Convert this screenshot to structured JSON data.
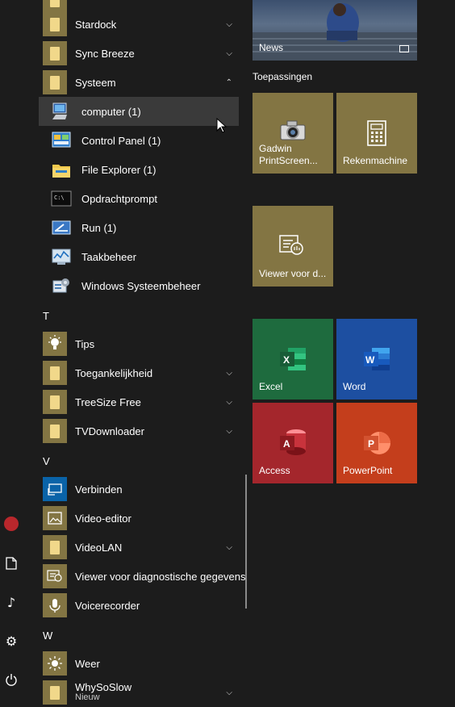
{
  "rail": {
    "icons": [
      "user-avatar",
      "documents-icon",
      "music-icon",
      "settings-icon",
      "power-icon"
    ]
  },
  "list": {
    "items": [
      {
        "type": "app",
        "label": "",
        "icon": "folder"
      },
      {
        "type": "app",
        "label": "Stardock",
        "icon": "folder",
        "chevron": "down"
      },
      {
        "type": "app",
        "label": "Sync Breeze",
        "icon": "folder",
        "chevron": "down"
      },
      {
        "type": "app",
        "label": "Systeem",
        "icon": "folder",
        "chevron": "up"
      },
      {
        "type": "sub",
        "label": "computer (1)",
        "icon": "computer",
        "highlighted": true
      },
      {
        "type": "sub",
        "label": "Control Panel (1)",
        "icon": "control-panel"
      },
      {
        "type": "sub",
        "label": "File Explorer (1)",
        "icon": "file-explorer"
      },
      {
        "type": "sub",
        "label": "Opdrachtprompt",
        "icon": "command-prompt"
      },
      {
        "type": "sub",
        "label": "Run (1)",
        "icon": "run"
      },
      {
        "type": "sub",
        "label": "Taakbeheer",
        "icon": "task-manager"
      },
      {
        "type": "sub",
        "label": "Windows Systeembeheer",
        "icon": "admin-tools"
      },
      {
        "type": "letter",
        "label": "T"
      },
      {
        "type": "app",
        "label": "Tips",
        "icon": "tips"
      },
      {
        "type": "app",
        "label": "Toegankelijkheid",
        "icon": "folder",
        "chevron": "down"
      },
      {
        "type": "app",
        "label": "TreeSize Free",
        "icon": "folder",
        "chevron": "down"
      },
      {
        "type": "app",
        "label": "TVDownloader",
        "icon": "folder",
        "chevron": "down"
      },
      {
        "type": "letter",
        "label": "V"
      },
      {
        "type": "app",
        "label": "Verbinden",
        "icon": "connect"
      },
      {
        "type": "app",
        "label": "Video-editor",
        "icon": "video-editor"
      },
      {
        "type": "app",
        "label": "VideoLAN",
        "icon": "folder",
        "chevron": "down"
      },
      {
        "type": "app",
        "label": "Viewer voor diagnostische gegevens",
        "icon": "diagnostics"
      },
      {
        "type": "app",
        "label": "Voicerecorder",
        "icon": "voice-recorder"
      },
      {
        "type": "letter",
        "label": "W"
      },
      {
        "type": "app",
        "label": "Weer",
        "icon": "weather"
      },
      {
        "type": "app",
        "label": "WhySoSlow",
        "icon": "folder",
        "chevron": "down",
        "sublabel": "Nieuw"
      }
    ]
  },
  "tiles": {
    "news_label": "News",
    "section_title": "Toepassingen",
    "gadwin_label": "Gadwin PrintScreen...",
    "rekenmachine_label": "Rekenmachine",
    "viewer_label": "Viewer voor d...",
    "excel_label": "Excel",
    "word_label": "Word",
    "access_label": "Access",
    "powerpoint_label": "PowerPoint"
  },
  "colors": {
    "excel": "#1e6b3e",
    "word": "#1d4fa1",
    "access": "#a4262c",
    "powerpoint": "#c43e1c",
    "olive": "#837543"
  }
}
